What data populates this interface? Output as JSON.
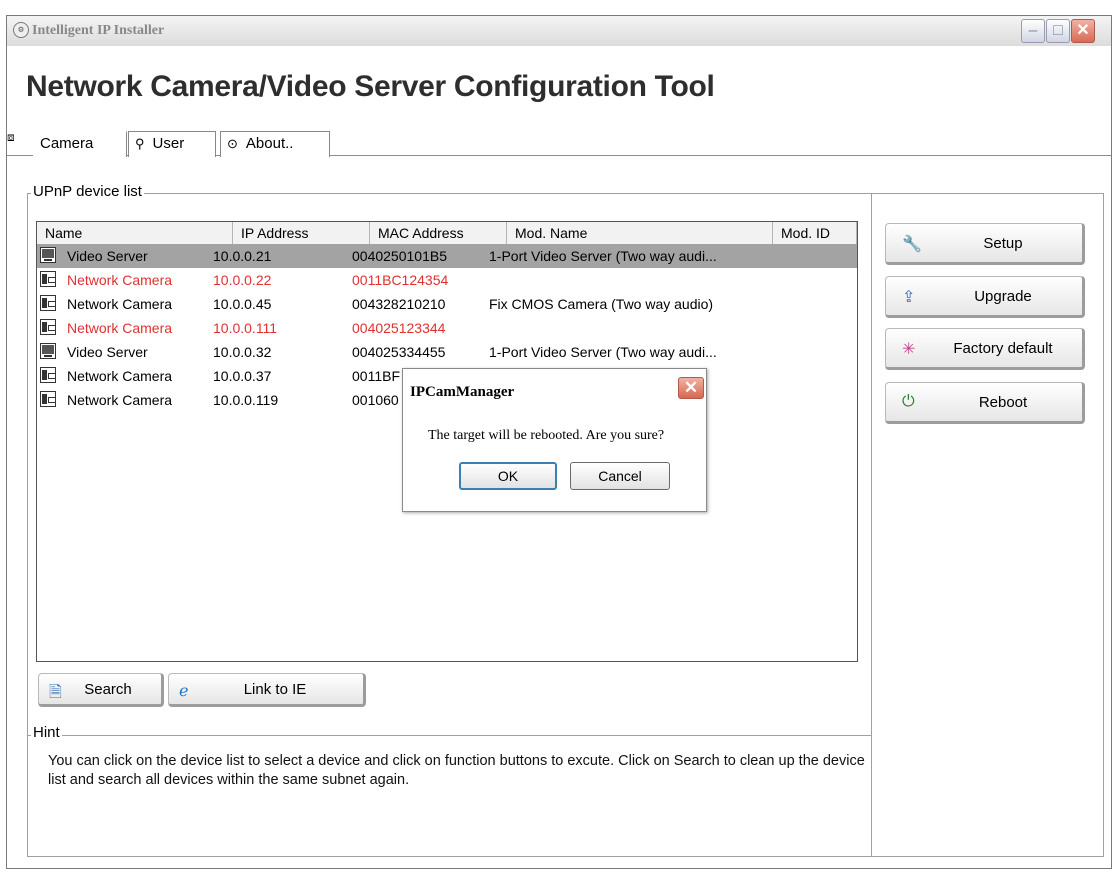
{
  "window": {
    "title": "Intelligent IP Installer",
    "heading": "Network Camera/Video Server Configuration Tool"
  },
  "tabs": [
    {
      "label": "Camera",
      "icon": "camera-icon"
    },
    {
      "label": "User",
      "icon": "user-icon"
    },
    {
      "label": "About..",
      "icon": "info-icon"
    }
  ],
  "device_list": {
    "group_label": "UPnP device list",
    "columns": [
      "Name",
      "IP Address",
      "MAC Address",
      "Mod. Name",
      "Mod. ID"
    ],
    "rows": [
      {
        "name": "Video Server",
        "ip": "10.0.0.21",
        "mac": "0040250101B5",
        "model": "1-Port Video Server (Two way audi...",
        "selected": true,
        "red": false,
        "type": "video-server"
      },
      {
        "name": "Network Camera",
        "ip": "10.0.0.22",
        "mac": "0011BC124354",
        "model": "",
        "selected": false,
        "red": true,
        "type": "network-camera"
      },
      {
        "name": "Network Camera",
        "ip": "10.0.0.45",
        "mac": "004328210210",
        "model": "Fix CMOS Camera (Two way audio)",
        "selected": false,
        "red": false,
        "type": "network-camera"
      },
      {
        "name": "Network Camera",
        "ip": "10.0.0.111",
        "mac": "004025123344",
        "model": "",
        "selected": false,
        "red": true,
        "type": "network-camera"
      },
      {
        "name": "Video Server",
        "ip": "10.0.0.32",
        "mac": "004025334455",
        "model": "1-Port Video Server (Two way audi...",
        "selected": false,
        "red": false,
        "type": "video-server"
      },
      {
        "name": "Network Camera",
        "ip": "10.0.0.37",
        "mac": "0011BF",
        "model": "...",
        "selected": false,
        "red": false,
        "type": "network-camera"
      },
      {
        "name": "Network Camera",
        "ip": "10.0.0.119",
        "mac": "001060",
        "model": "...",
        "selected": false,
        "red": false,
        "type": "network-camera"
      }
    ]
  },
  "list_buttons": {
    "search": "Search",
    "link_ie": "Link to IE"
  },
  "side_buttons": [
    {
      "label": "Setup",
      "icon": "wrench-icon",
      "glyph": "🔧",
      "color": "#2a6db5"
    },
    {
      "label": "Upgrade",
      "icon": "upgrade-icon",
      "glyph": "⇪",
      "color": "#2a6db5"
    },
    {
      "label": "Factory default",
      "icon": "factory-default-icon",
      "glyph": "✳",
      "color": "#c04090"
    },
    {
      "label": "Reboot",
      "icon": "power-icon",
      "glyph": "⏻",
      "color": "#2e7d32"
    }
  ],
  "hint": {
    "label": "Hint",
    "text": "You can click on the device list to select a device and click on function buttons to excute. Click on Search to clean up the device list and search all devices  within the same subnet again."
  },
  "dialog": {
    "title": "IPCamManager",
    "message": "The target will be rebooted. Are you sure?",
    "ok": "OK",
    "cancel": "Cancel"
  }
}
